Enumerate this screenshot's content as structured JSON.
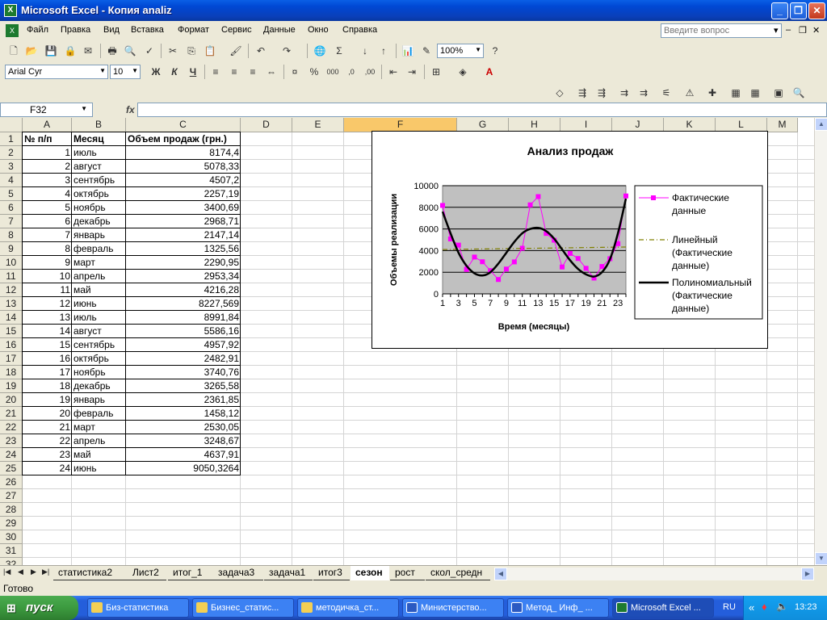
{
  "window": {
    "title": "Microsoft Excel - Копия analiz"
  },
  "menu": {
    "items": [
      "Файл",
      "Правка",
      "Вид",
      "Вставка",
      "Формат",
      "Сервис",
      "Данные",
      "Окно",
      "Справка"
    ],
    "help_placeholder": "Введите вопрос"
  },
  "toolbar": {
    "zoom": "100%",
    "font_name": "Arial Cyr",
    "font_size": "10",
    "bold": "Ж",
    "italic": "К",
    "underline": "Ч"
  },
  "formula_bar": {
    "name_box": "F32",
    "fx": "fx",
    "formula": ""
  },
  "columns": [
    "A",
    "B",
    "C",
    "D",
    "E",
    "F",
    "G",
    "H",
    "I",
    "J",
    "K",
    "L",
    "M"
  ],
  "selected_column": "F",
  "rows": [
    "1",
    "2",
    "3",
    "4",
    "5",
    "6",
    "7",
    "8",
    "9",
    "10",
    "11",
    "12",
    "13",
    "14",
    "15",
    "16",
    "17",
    "18",
    "19",
    "20",
    "21",
    "22",
    "23",
    "24",
    "25",
    "26",
    "27",
    "28",
    "29",
    "30",
    "31",
    "32"
  ],
  "table": {
    "headers": [
      "№ п/п",
      "Месяц",
      "Объем продаж (грн.)"
    ],
    "rows": [
      [
        "1",
        "июль",
        "8174,4"
      ],
      [
        "2",
        "август",
        "5078,33"
      ],
      [
        "3",
        "сентябрь",
        "4507,2"
      ],
      [
        "4",
        "октябрь",
        "2257,19"
      ],
      [
        "5",
        "ноябрь",
        "3400,69"
      ],
      [
        "6",
        "декабрь",
        "2968,71"
      ],
      [
        "7",
        "январь",
        "2147,14"
      ],
      [
        "8",
        "февраль",
        "1325,56"
      ],
      [
        "9",
        "март",
        "2290,95"
      ],
      [
        "10",
        "апрель",
        "2953,34"
      ],
      [
        "11",
        "май",
        "4216,28"
      ],
      [
        "12",
        "июнь",
        "8227,569"
      ],
      [
        "13",
        "июль",
        "8991,84"
      ],
      [
        "14",
        "август",
        "5586,16"
      ],
      [
        "15",
        "сентябрь",
        "4957,92"
      ],
      [
        "16",
        "октябрь",
        "2482,91"
      ],
      [
        "17",
        "ноябрь",
        "3740,76"
      ],
      [
        "18",
        "декабрь",
        "3265,58"
      ],
      [
        "19",
        "январь",
        "2361,85"
      ],
      [
        "20",
        "февраль",
        "1458,12"
      ],
      [
        "21",
        "март",
        "2530,05"
      ],
      [
        "22",
        "апрель",
        "3248,67"
      ],
      [
        "23",
        "май",
        "4637,91"
      ],
      [
        "24",
        "июнь",
        "9050,3264"
      ]
    ]
  },
  "chart_data": {
    "type": "line",
    "title": "Анализ продаж",
    "xlabel": "Время (месяцы)",
    "ylabel": "Объемы реализации",
    "x": [
      1,
      2,
      3,
      4,
      5,
      6,
      7,
      8,
      9,
      10,
      11,
      12,
      13,
      14,
      15,
      16,
      17,
      18,
      19,
      20,
      21,
      22,
      23,
      24
    ],
    "x_tick_labels": [
      "1",
      "3",
      "5",
      "7",
      "9",
      "11",
      "13",
      "15",
      "17",
      "19",
      "21",
      "23"
    ],
    "y_ticks": [
      "0",
      "2000",
      "4000",
      "6000",
      "8000",
      "10000"
    ],
    "ylim": [
      0,
      10000
    ],
    "grid": true,
    "legend_position": "right",
    "plot_background": "#C0C0C0",
    "series": [
      {
        "name": "Фактические данные",
        "color": "#FF00FF",
        "style": "line-markers",
        "values": [
          8174.4,
          5078.33,
          4507.2,
          2257.19,
          3400.69,
          2968.71,
          2147.14,
          1325.56,
          2290.95,
          2953.34,
          4216.28,
          8227.569,
          8991.84,
          5586.16,
          4957.92,
          2482.91,
          3740.76,
          3265.58,
          2361.85,
          1458.12,
          2530.05,
          3248.67,
          4637.91,
          9050.3264
        ]
      },
      {
        "name": "Линейный (Фактические данные)",
        "color": "#808000",
        "style": "dashdot",
        "values": [
          4100,
          4110,
          4120,
          4130,
          4140,
          4150,
          4160,
          4170,
          4180,
          4190,
          4200,
          4210,
          4220,
          4230,
          4240,
          4250,
          4260,
          4270,
          4280,
          4290,
          4300,
          4310,
          4320,
          4330
        ]
      },
      {
        "name": "Полиномиальный (Фактические данные)",
        "color": "#000000",
        "style": "smooth",
        "values": [
          7600,
          5600,
          3800,
          2600,
          1900,
          1700,
          2000,
          2800,
          3800,
          4800,
          5600,
          6000,
          6100,
          5800,
          5100,
          4100,
          3100,
          2300,
          1800,
          1600,
          2000,
          3200,
          5600,
          8800
        ]
      }
    ],
    "legend_lines": [
      [
        "Фактические",
        "данные"
      ],
      [
        "Линейный",
        "(Фактические",
        "данные)"
      ],
      [
        "Полиномиальный",
        "(Фактические",
        "данные)"
      ]
    ]
  },
  "sheet_tabs": {
    "tabs": [
      "статистика2",
      "Лист2",
      "итог_1",
      "задача3",
      "задача1",
      "итог3",
      "сезон",
      "рост",
      "скол_средн"
    ],
    "active": "сезон"
  },
  "status": "Готово",
  "taskbar": {
    "start": "пуск",
    "tasks": [
      "Биз-статистика",
      "Бизнес_статис...",
      "методичка_ст...",
      "Министерство...",
      "Метод_ Инф_ ...",
      "Microsoft Excel ..."
    ],
    "lang": "RU",
    "clock": "13:23"
  }
}
